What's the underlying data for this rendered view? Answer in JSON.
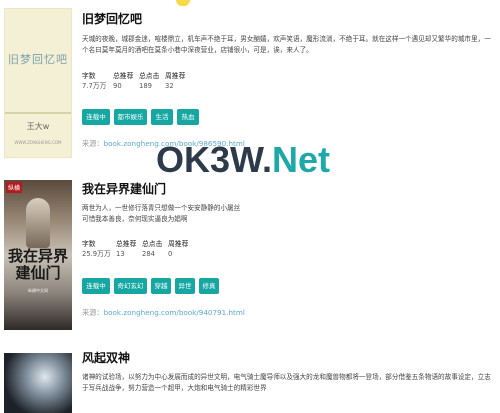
{
  "watermark": {
    "part1": "OK3W.",
    "part2": "Net"
  },
  "books": [
    {
      "title": "旧梦回忆吧",
      "cover": {
        "title": "旧梦回忆吧",
        "author": "王大w",
        "url": "WWW.ZONGHENG.COM"
      },
      "description": "天城的夜晚，城郡金迷，喧楼鼎立，机车声不绝于耳，男女酗嬉，欢声笑语，魔形流淌，不绝于耳。就在这样一个遇见却又繁华的城市里，一个名曰莫年莫月的酒吧在莫条小巷中深夜营业，店铺很小，可是，诶，来人了。",
      "stats": [
        {
          "label": "字数",
          "value": "7.7万万"
        },
        {
          "label": "总推荐",
          "value": "90"
        },
        {
          "label": "总点击",
          "value": "189"
        },
        {
          "label": "周推荐",
          "value": "32"
        }
      ],
      "tags": [
        "连载中",
        "都市娱乐",
        "生活",
        "热血"
      ],
      "source_label": "来源：",
      "source_link": "book.zongheng.com/book/986590.html"
    },
    {
      "title": "我在异界建仙门",
      "cover": {
        "badge": "纵横",
        "title": "我在异界建仙门",
        "subtitle": "纵横中文网"
      },
      "description": "两世为人，一世修行落青只想做一个安安静静的小屠丝可惜我本善良，奈何现实逼良为娼啊",
      "stats": [
        {
          "label": "字数",
          "value": "25.9万万"
        },
        {
          "label": "总推荐",
          "value": "13"
        },
        {
          "label": "总点击",
          "value": "284"
        },
        {
          "label": "周推荐",
          "value": "0"
        }
      ],
      "tags": [
        "连载中",
        "奇幻玄幻",
        "穿越",
        "异世",
        "修真"
      ],
      "source_label": "来源：",
      "source_link": "book.zongheng.com/book/940791.html"
    },
    {
      "title": "风起双神",
      "description": "诸神的试验场，以努力为中心发展而成的异世文明，电气骑士魔导师以及强大的龙和魔兽物都将一登场，部分借鉴五条物语的故事设定，立志于写兵战战争，努力营造一个超甲，大炮和电气骑士的精彩世界"
    }
  ]
}
